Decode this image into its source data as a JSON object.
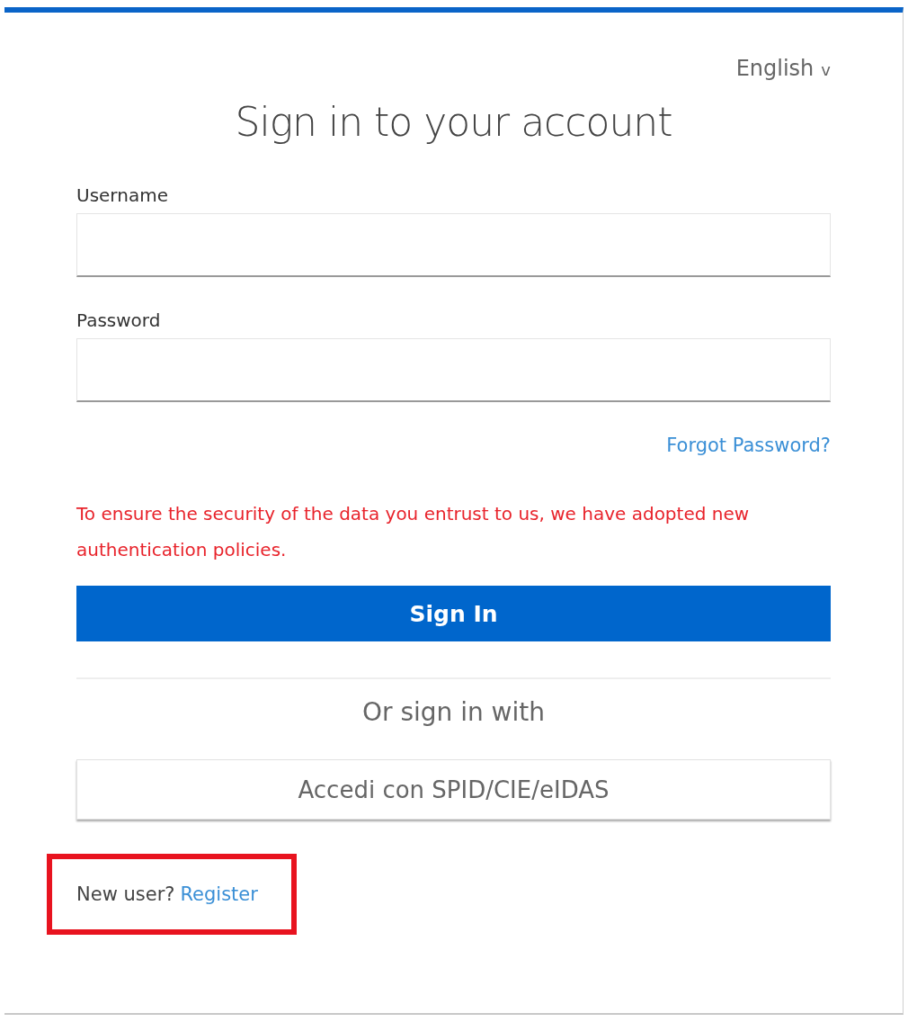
{
  "language": {
    "label": "English",
    "caret": "v"
  },
  "title": "Sign in to your account",
  "fields": [
    {
      "label": "Username"
    },
    {
      "label": "Password"
    }
  ],
  "forgot_link": "Forgot Password?",
  "notice": "To ensure the security of the data you entrust to us, we have adopted new authentication policies.",
  "primary_button": "Sign In",
  "alt_heading": "Or sign in with",
  "alt_buttons": [
    "Accedi con SPID/CIE/eIDAS"
  ],
  "register": {
    "prompt": "New user?",
    "link": "Register",
    "highlighted": true
  }
}
